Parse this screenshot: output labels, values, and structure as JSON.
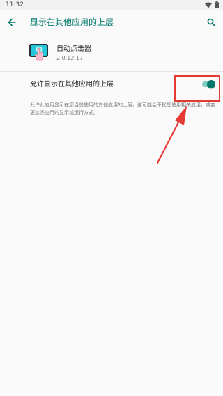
{
  "status_bar": {
    "time": "11:32",
    "icons": [
      "wifi-icon",
      "battery-icon"
    ]
  },
  "toolbar": {
    "title": "显示在其他应用的上层",
    "back_icon": "arrow-back-icon",
    "search_icon": "search-icon"
  },
  "app": {
    "name": "自动点击器",
    "version": "2.0.12.17",
    "icon": "auto-clicker-app-icon"
  },
  "setting": {
    "label": "允许显示在其他应用的上层",
    "enabled": true,
    "description": "允许此应用显示在您当前使用的其他应用的上层。这可能会干扰您使用相关应用，或变更这类应用的显示或运行方式。"
  },
  "colors": {
    "accent": "#00796b",
    "accent_light": "#80cbc4",
    "annotation": "#e53935",
    "background": "#fafafa"
  },
  "annotations": {
    "highlight": "red-rectangle",
    "arrow": "red-arrow"
  }
}
